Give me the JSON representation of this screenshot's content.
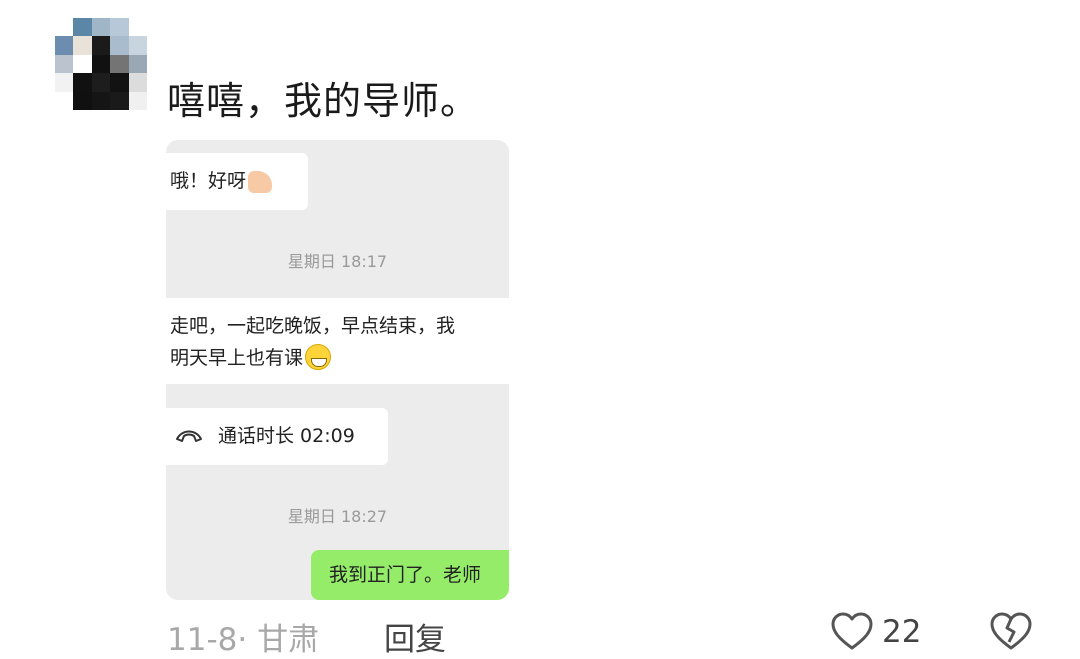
{
  "comment": {
    "text": "嘻嘻，我的导师。",
    "date_location": "11-8· 甘肃",
    "reply_label": "回复",
    "like_count": "22"
  },
  "chat": {
    "msg1": "哦！好呀",
    "time1": "星期日 18:17",
    "msg2_line1": "走吧，一起吃晚饭，早点结束，我",
    "msg2_line2": "明天早上也有课",
    "call_text": "通话时长 02:09",
    "time2": "星期日 18:27",
    "msg3": "我到正门了。老师"
  },
  "icons": {
    "like": "heart-outline-icon",
    "dislike": "broken-heart-icon",
    "call": "phone-hangup-icon",
    "emoji1": "thumbs-up-emoji",
    "emoji2": "grinning-face-emoji"
  },
  "colors": {
    "sent_bubble": "#95ec69",
    "chat_bg": "#ececec",
    "timestamp": "#9a9a9a"
  }
}
